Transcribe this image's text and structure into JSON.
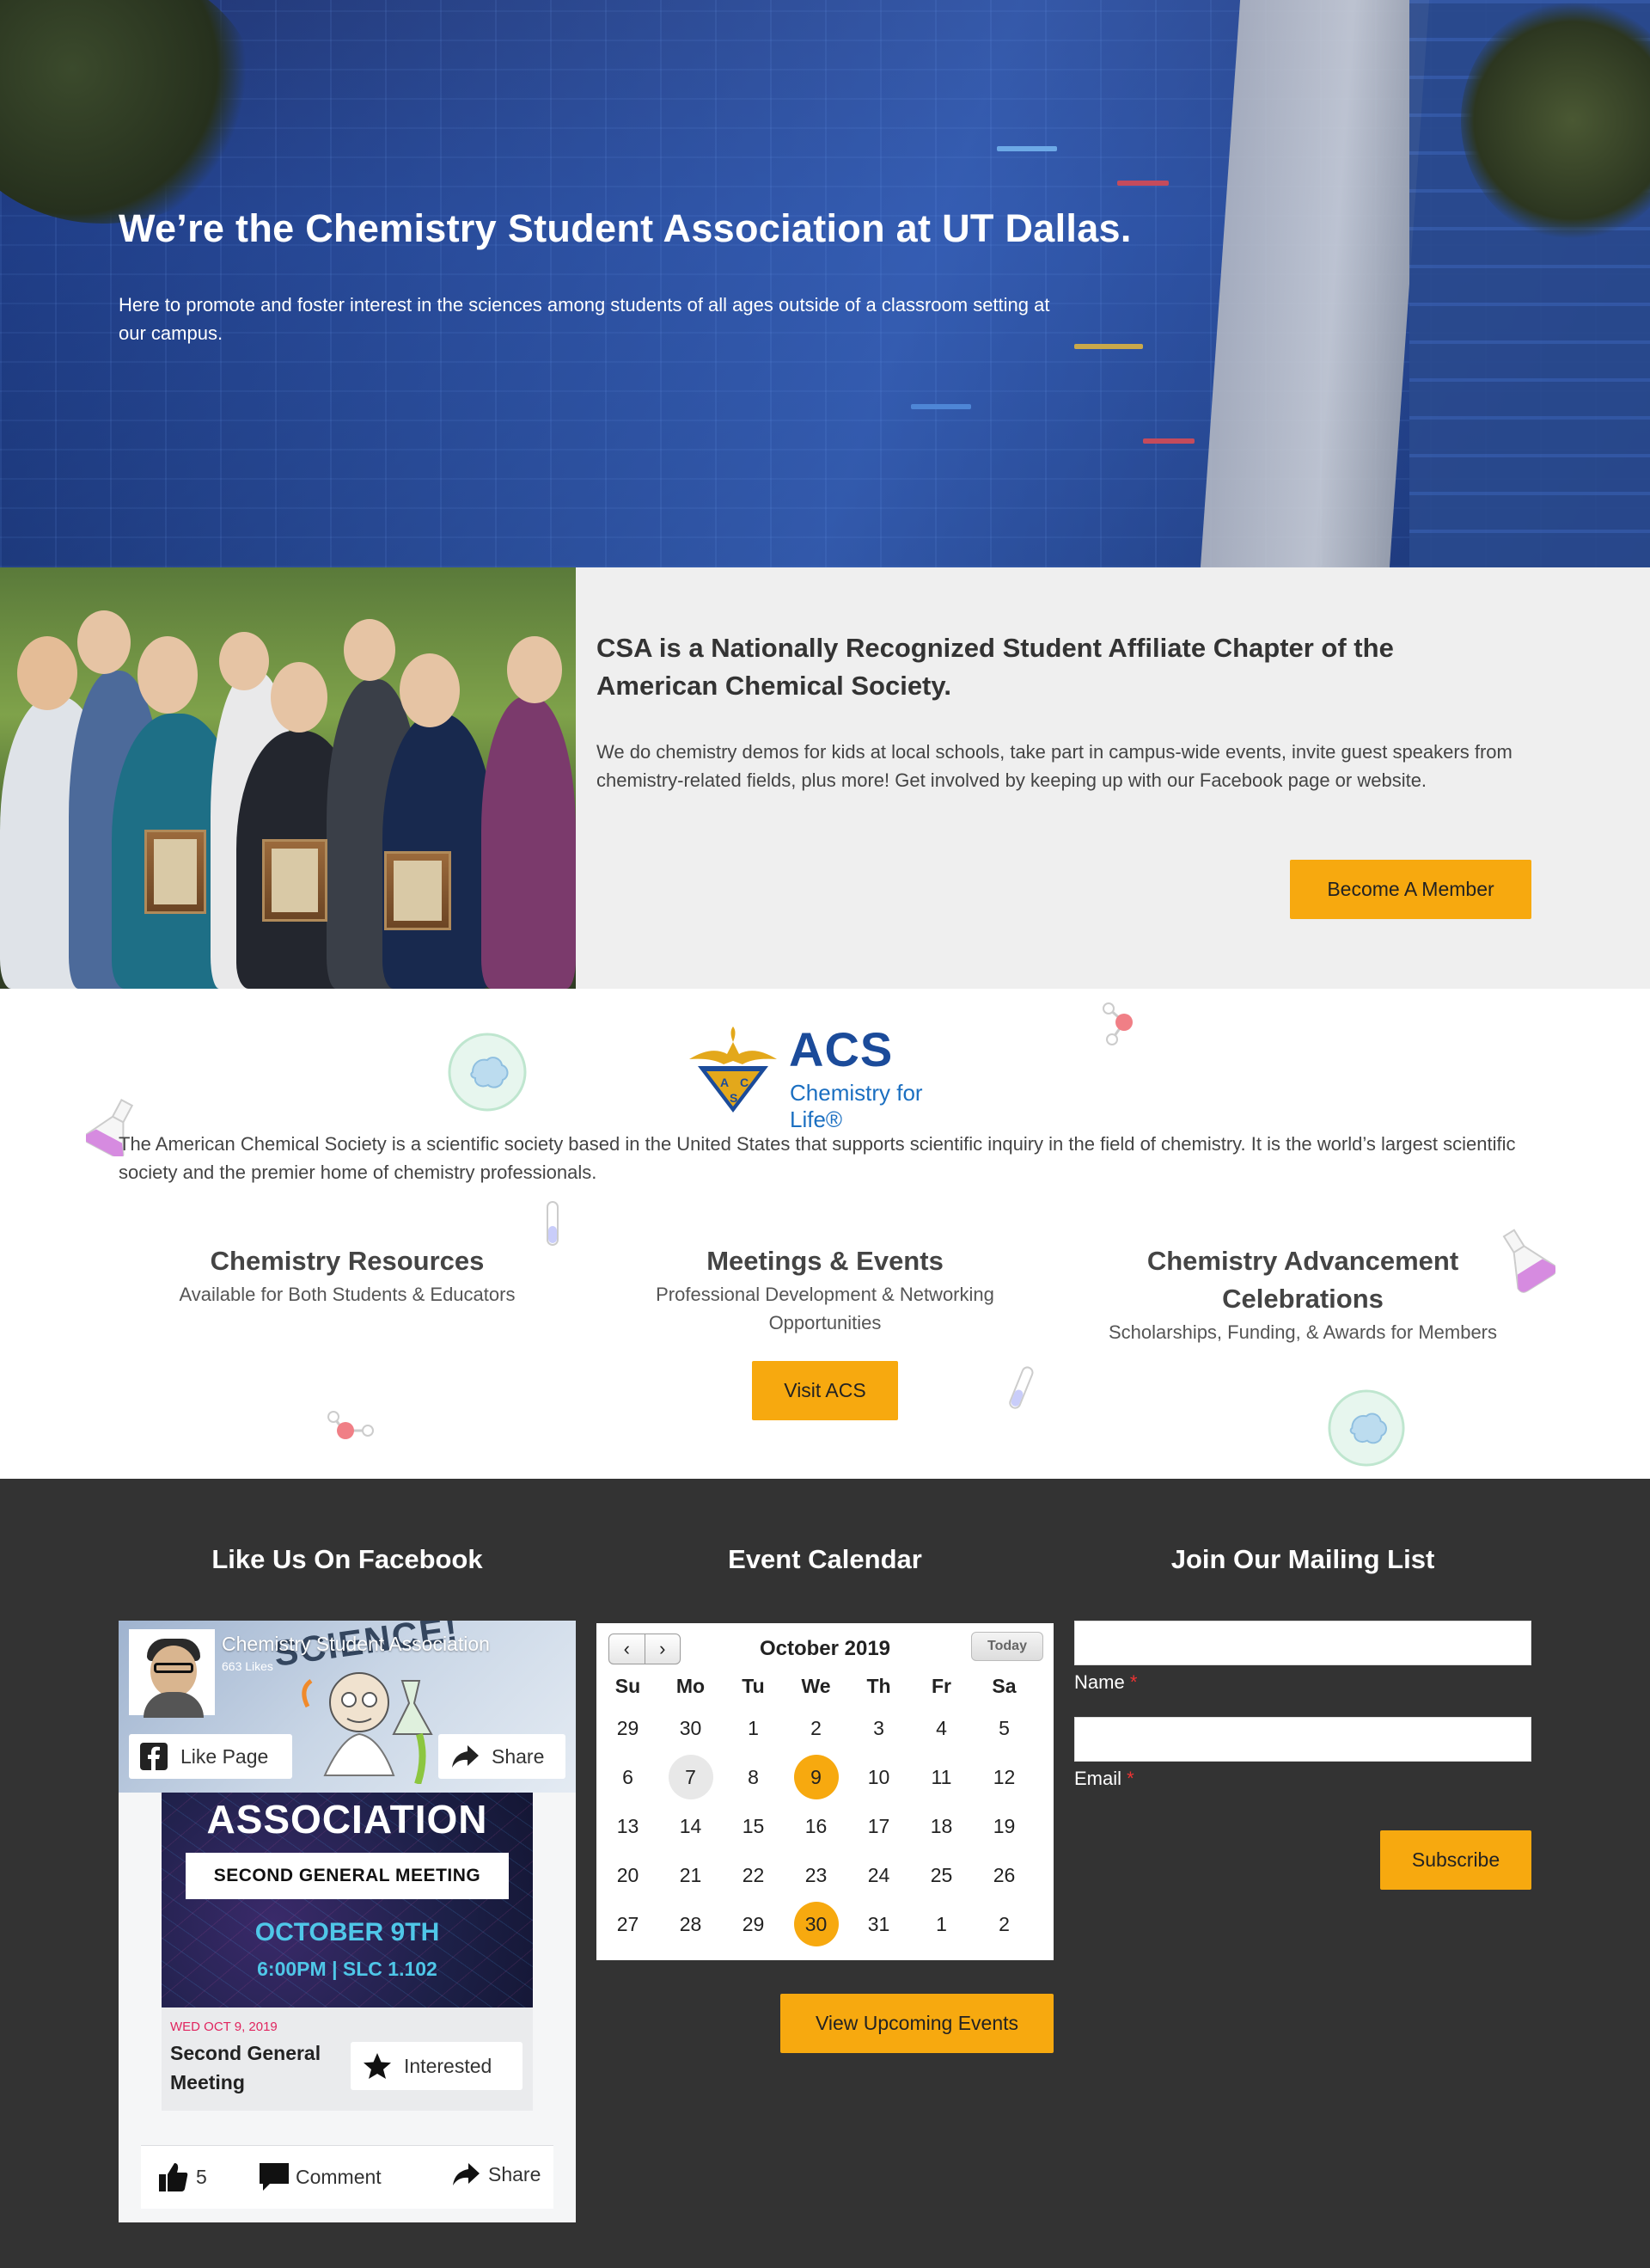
{
  "hero": {
    "title": "We’re the Chemistry Student Association at UT Dallas.",
    "subtitle": "Here to promote and foster interest in the sciences among students of all ages outside of a classroom setting at our campus."
  },
  "csa": {
    "heading": "CSA is a Nationally Recognized Student Affiliate Chapter of the American Chemical Society.",
    "body": "We do chemistry demos for kids at local schools, take part in campus-wide events, invite guest speakers from chemistry-related fields, plus more! Get involved by keeping up with our Facebook page or website.",
    "button": "Become A Member"
  },
  "acs": {
    "logo_text": "ACS",
    "logo_tagline": "Chemistry for Life®",
    "logo_seal_letters": "A C S",
    "description": "The American Chemical Society is a scientific society based in the United States that supports scientific inquiry in the field of chemistry. It is the world’s largest scientific society and the premier home of chemistry professionals.",
    "columns": [
      {
        "title": "Chemistry Resources",
        "subtitle": "Available for Both Students & Educators"
      },
      {
        "title": "Meetings & Events",
        "subtitle": "Professional Development & Networking Opportunities"
      },
      {
        "title": "Chemistry Advancement Celebrations",
        "subtitle": "Scholarships, Funding, & Awards for Members"
      }
    ],
    "button": "Visit ACS"
  },
  "footer": {
    "facebook_heading": "Like Us On Facebook",
    "calendar_heading": "Event Calendar",
    "mailing_heading": "Join Our Mailing List"
  },
  "facebook": {
    "page_name": "Chemistry Student Association",
    "likes": "663 Likes",
    "cover_text": "SCIENCE!",
    "like_button": "Like Page",
    "share_button": "Share",
    "post_title": "ASSOCIATION",
    "post_banner": "SECOND GENERAL MEETING",
    "post_date": "OCTOBER 9TH",
    "post_time": "6:00PM | SLC 1.102",
    "event_date": "WED OCT 9, 2019",
    "event_title": "Second General Meeting",
    "interested": "Interested",
    "like_count": "5",
    "comment": "Comment",
    "share": "Share"
  },
  "calendar": {
    "title": "October 2019",
    "today_button": "Today",
    "prev": "‹",
    "next": "›",
    "weekdays": [
      "Su",
      "Mo",
      "Tu",
      "We",
      "Th",
      "Fr",
      "Sa"
    ],
    "weeks": [
      [
        "29",
        "30",
        "1",
        "2",
        "3",
        "4",
        "5"
      ],
      [
        "6",
        "7",
        "8",
        "9",
        "10",
        "11",
        "12"
      ],
      [
        "13",
        "14",
        "15",
        "16",
        "17",
        "18",
        "19"
      ],
      [
        "20",
        "21",
        "22",
        "23",
        "24",
        "25",
        "26"
      ],
      [
        "27",
        "28",
        "29",
        "30",
        "31",
        "1",
        "2"
      ]
    ],
    "today": "7",
    "event_days": [
      "9",
      "30"
    ],
    "button": "View Upcoming Events"
  },
  "mailing": {
    "name_label": "Name",
    "email_label": "Email",
    "required_mark": "*",
    "subscribe": "Subscribe"
  },
  "colors": {
    "accent": "#f7a90f",
    "footer_bg": "#333333",
    "section_bg": "#efefef"
  }
}
